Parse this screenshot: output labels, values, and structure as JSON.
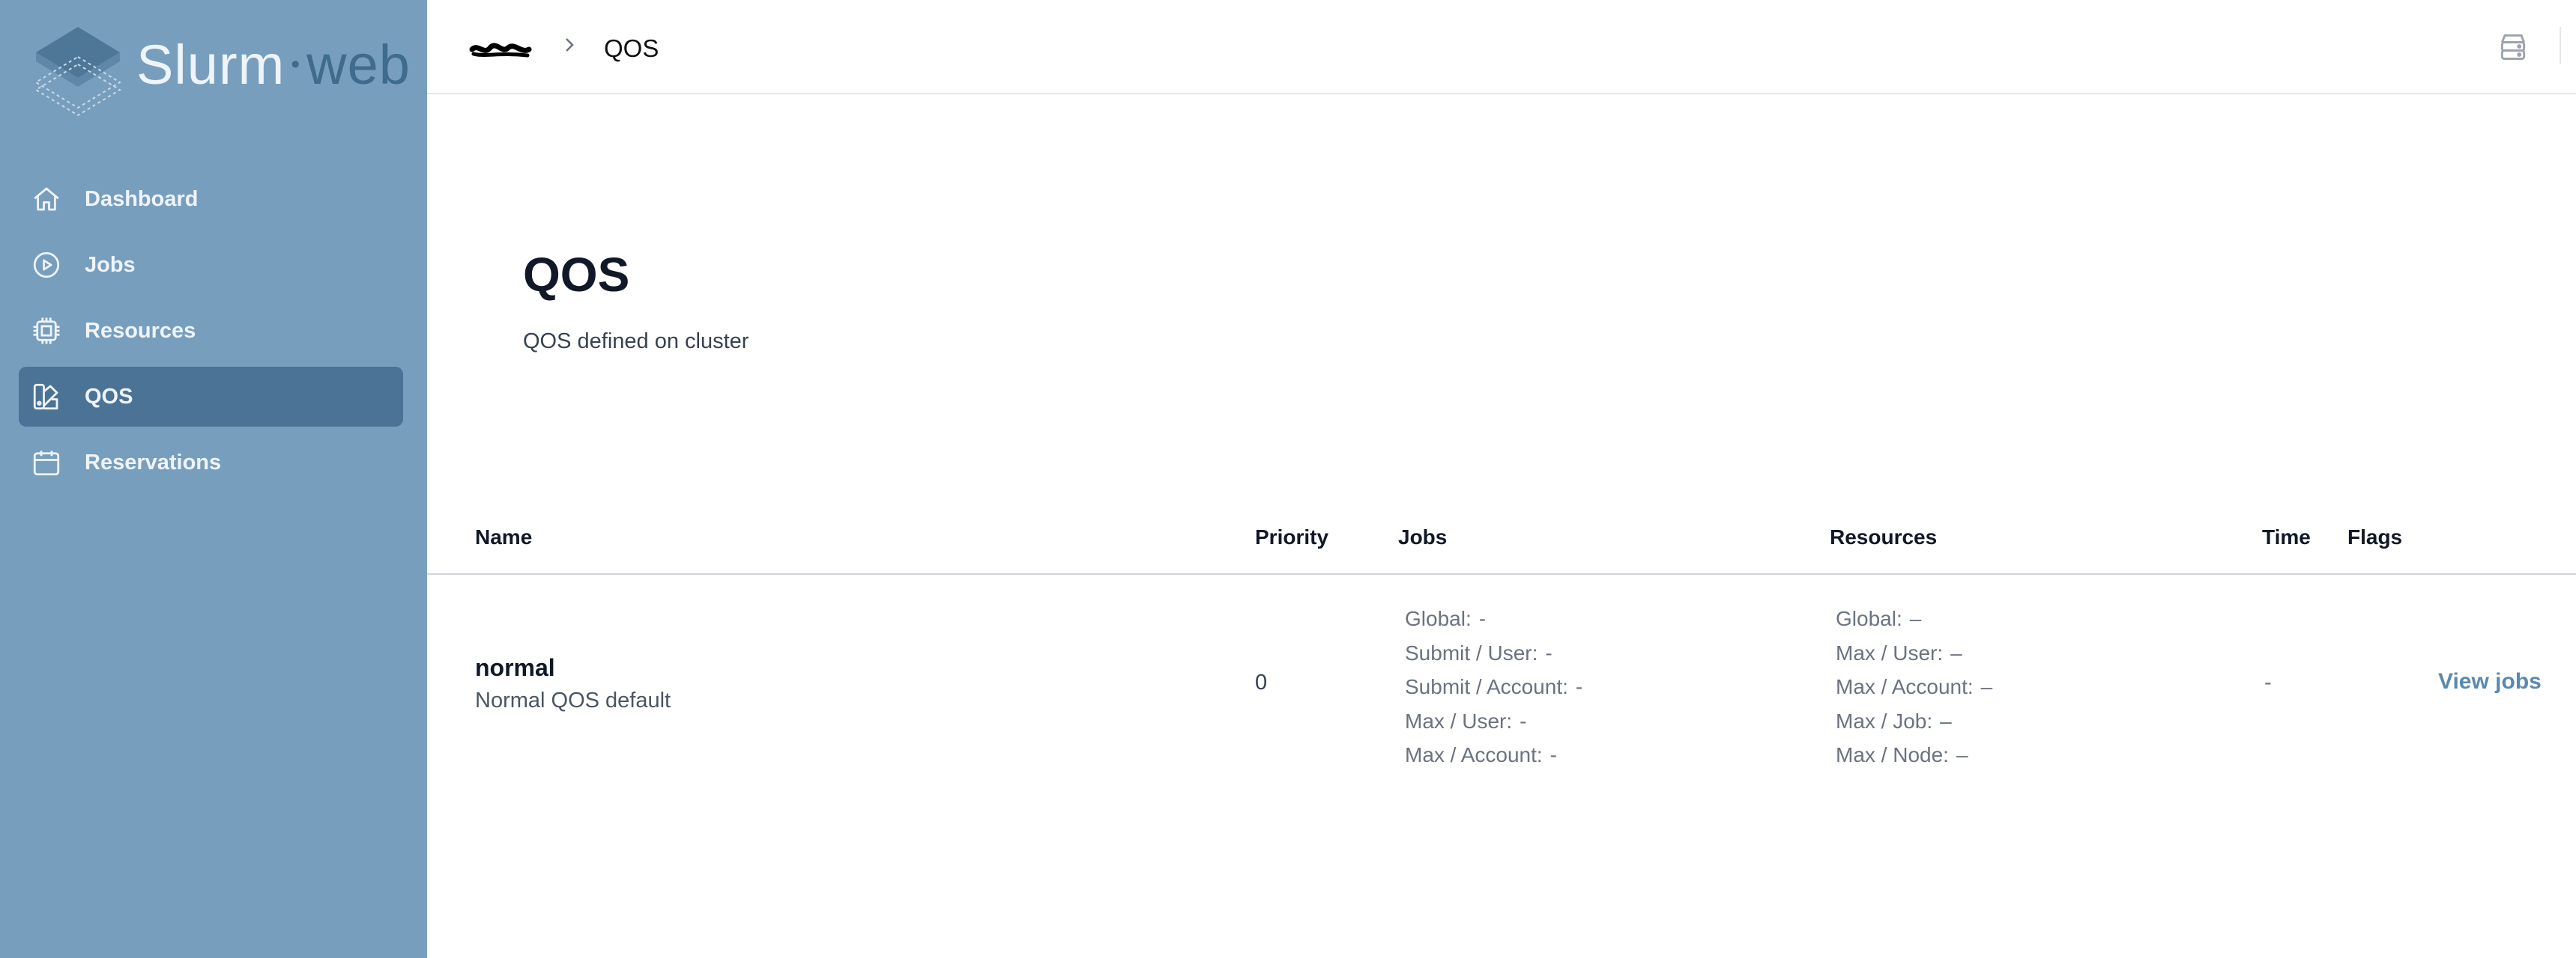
{
  "app": {
    "logo_primary": "Slurm",
    "logo_separator": "•",
    "logo_secondary": "web"
  },
  "colors": {
    "sidebar_bg": "#789ebd",
    "sidebar_active": "#4a7396",
    "link": "#5a89b0"
  },
  "sidebar": {
    "items": [
      {
        "label": "Dashboard",
        "icon": "home-icon"
      },
      {
        "label": "Jobs",
        "icon": "play-circle-icon"
      },
      {
        "label": "Resources",
        "icon": "cpu-chip-icon"
      },
      {
        "label": "QOS",
        "icon": "swatch-icon",
        "active": true
      },
      {
        "label": "Reservations",
        "icon": "calendar-icon"
      }
    ]
  },
  "header": {
    "breadcrumb_current": "QOS",
    "right_icon": "server-stack-icon"
  },
  "page": {
    "title": "QOS",
    "description": "QOS defined on cluster"
  },
  "table": {
    "columns": [
      "Name",
      "Priority",
      "Jobs",
      "Resources",
      "Time",
      "Flags"
    ],
    "rows": [
      {
        "name": "normal",
        "description": "Normal QOS default",
        "priority": "0",
        "jobs": [
          {
            "label": "Global:",
            "value": "-"
          },
          {
            "label": "Submit / User:",
            "value": "-"
          },
          {
            "label": "Submit / Account:",
            "value": "-"
          },
          {
            "label": "Max / User:",
            "value": "-"
          },
          {
            "label": "Max / Account:",
            "value": "-"
          }
        ],
        "resources": [
          {
            "label": "Global:",
            "value": "–"
          },
          {
            "label": "Max / User:",
            "value": "–"
          },
          {
            "label": "Max / Account:",
            "value": "–"
          },
          {
            "label": "Max / Job:",
            "value": "–"
          },
          {
            "label": "Max / Node:",
            "value": "–"
          }
        ],
        "time": "-",
        "action": "View jobs"
      }
    ]
  }
}
